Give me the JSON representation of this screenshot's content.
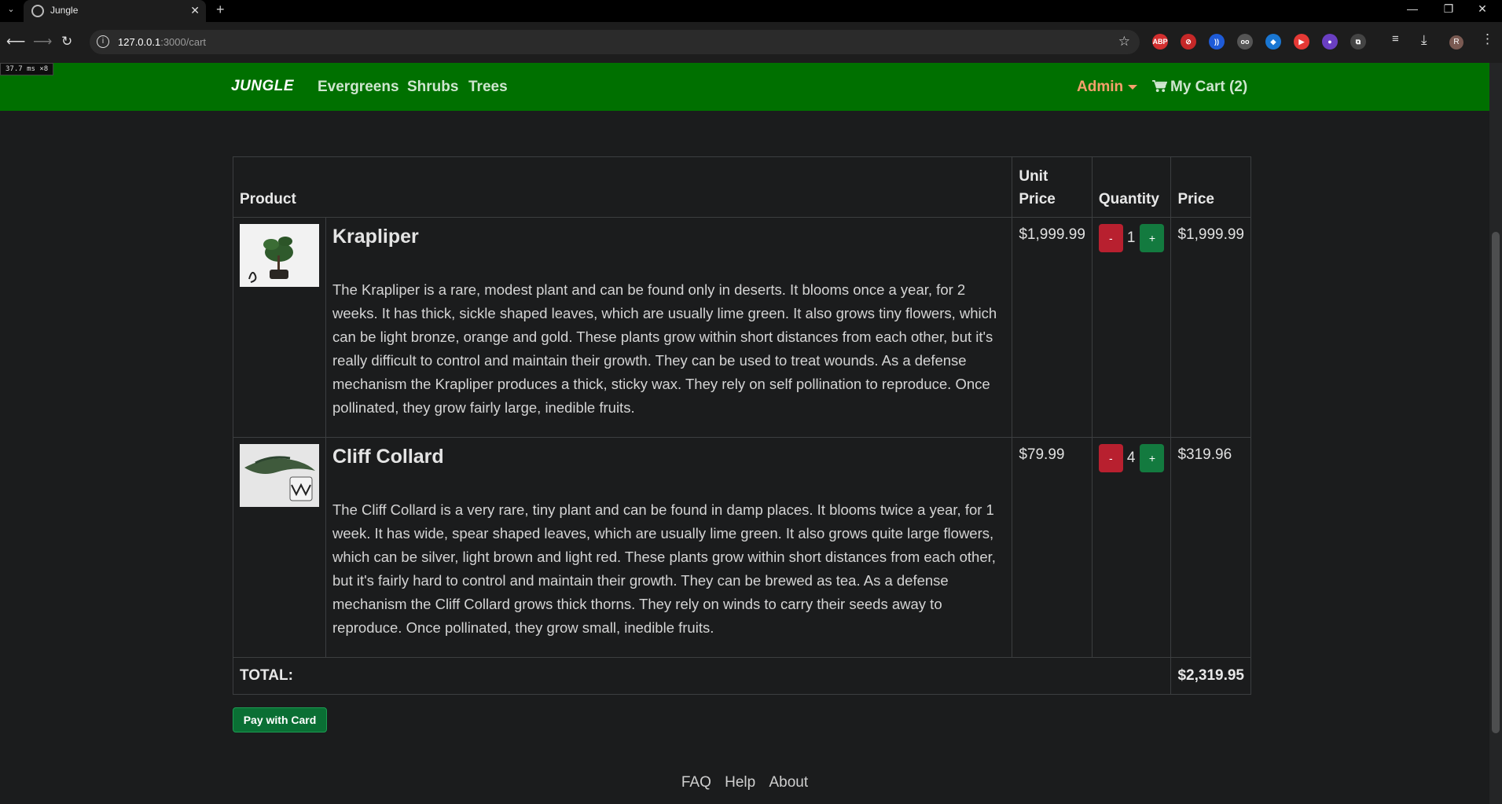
{
  "browser": {
    "tab_title": "Jungle",
    "url_host": "127.0.0.1",
    "url_path": ":3000/cart",
    "extensions": [
      {
        "name": "adblock-icon",
        "label": "ABP",
        "color": "#d32f2f"
      },
      {
        "name": "blocker-icon",
        "label": "⊘",
        "color": "#c62828"
      },
      {
        "name": "wifi-ext-icon",
        "label": "))",
        "color": "#1e5bd8"
      },
      {
        "name": "glasses-ext-icon",
        "label": "oo",
        "color": "#555"
      },
      {
        "name": "shield-ext-icon",
        "label": "◆",
        "color": "#1976d2"
      },
      {
        "name": "video-ext-icon",
        "label": "▶",
        "color": "#e53935"
      },
      {
        "name": "color-ext-icon",
        "label": "●",
        "color": "#6a3fc2"
      },
      {
        "name": "puzzle-icon",
        "label": "⧉",
        "color": "#444"
      }
    ],
    "avatar_initial": "R"
  },
  "perf_badge": "37.7 ms ×8",
  "navbar": {
    "brand": "JUNGLE",
    "links": [
      "Evergreens",
      "Shrubs",
      "Trees"
    ],
    "admin": "Admin",
    "cart": "My Cart (2)"
  },
  "table": {
    "headers": {
      "product": "Product",
      "unit_price": "Unit Price",
      "quantity": "Quantity",
      "price": "Price"
    },
    "rows": [
      {
        "name": "Krapliper",
        "description": "The Krapliper is a rare, modest plant and can be found only in deserts. It blooms once a year, for 2 weeks. It has thick, sickle shaped leaves, which are usually lime green. It also grows tiny flowers, which can be light bronze, orange and gold. These plants grow within short distances from each other, but it's really difficult to control and maintain their growth. They can be used to treat wounds. As a defense mechanism the Krapliper produces a thick, sticky wax. They rely on self pollination to reproduce. Once pollinated, they grow fairly large, inedible fruits.",
        "unit_price": "$1,999.99",
        "quantity": "1",
        "price": "$1,999.99"
      },
      {
        "name": "Cliff Collard",
        "description": "The Cliff Collard is a very rare, tiny plant and can be found in damp places. It blooms twice a year, for 1 week. It has wide, spear shaped leaves, which are usually lime green. It also grows quite large flowers, which can be silver, light brown and light red. These plants grow within short distances from each other, but it's fairly hard to control and maintain their growth. They can be brewed as tea. As a defense mechanism the Cliff Collard grows thick thorns. They rely on winds to carry their seeds away to reproduce. Once pollinated, they grow small, inedible fruits.",
        "unit_price": "$79.99",
        "quantity": "4",
        "price": "$319.96"
      }
    ],
    "minus_label": "-",
    "plus_label": "+",
    "total_label": "TOTAL:",
    "total_value": "$2,319.95"
  },
  "pay_button": "Pay with Card",
  "footer": [
    "FAQ",
    "Help",
    "About"
  ],
  "colors": {
    "navbar_bg": "#007000",
    "admin": "#f4a06c",
    "minus_btn": "#b8202f",
    "plus_btn": "#137a3f",
    "pay_btn": "#0a6f34"
  }
}
